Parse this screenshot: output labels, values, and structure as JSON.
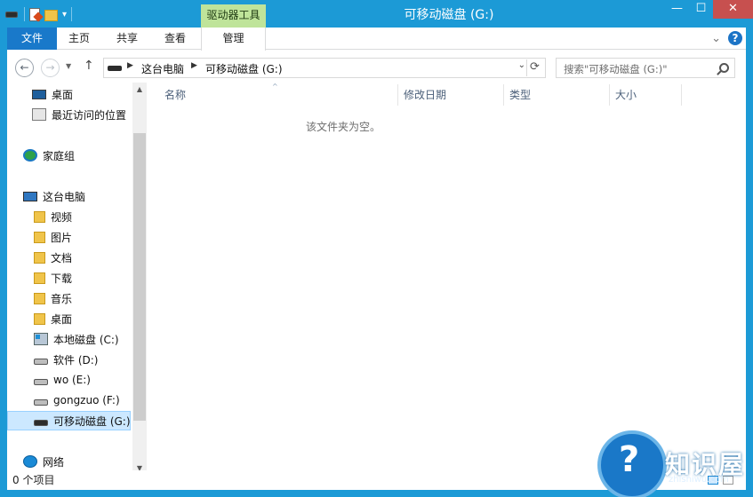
{
  "window": {
    "title": "可移动磁盘 (G:)",
    "contextual_tab_group": "驱动器工具",
    "minimize": "—",
    "maximize": "☐",
    "close": "✕"
  },
  "quick_access": {
    "dropdown": "▾"
  },
  "ribbon": {
    "tabs": [
      "文件",
      "主页",
      "共享",
      "查看",
      "管理"
    ],
    "expand_glyph": "⌄",
    "help_glyph": "?"
  },
  "navbar": {
    "back": "←",
    "forward": "→",
    "recent": "▼",
    "up": "↑",
    "breadcrumb": [
      "这台电脑",
      "可移动磁盘 (G:)"
    ],
    "separator": "▶",
    "dropdown": "⌄",
    "refresh": "⟳",
    "search_placeholder": "搜索\"可移动磁盘 (G:)\""
  },
  "nav_pane": {
    "items": [
      {
        "label": "桌面",
        "icon": "desktop-icon"
      },
      {
        "label": "最近访问的位置",
        "icon": "recent-places-icon"
      },
      {
        "label": "家庭组",
        "icon": "homegroup-icon"
      },
      {
        "label": "这台电脑",
        "icon": "computer-icon"
      },
      {
        "label": "视频",
        "icon": "videos-folder-icon"
      },
      {
        "label": "图片",
        "icon": "pictures-folder-icon"
      },
      {
        "label": "文档",
        "icon": "documents-folder-icon"
      },
      {
        "label": "下载",
        "icon": "downloads-folder-icon"
      },
      {
        "label": "音乐",
        "icon": "music-folder-icon"
      },
      {
        "label": "桌面",
        "icon": "desktop-folder-icon"
      },
      {
        "label": "本地磁盘 (C:)",
        "icon": "local-disk-icon"
      },
      {
        "label": "软件 (D:)",
        "icon": "drive-icon"
      },
      {
        "label": "wo (E:)",
        "icon": "drive-icon"
      },
      {
        "label": "gongzuo (F:)",
        "icon": "drive-icon"
      },
      {
        "label": "可移动磁盘 (G:)",
        "icon": "usb-drive-icon",
        "selected": true
      },
      {
        "label": "网络",
        "icon": "network-icon"
      }
    ],
    "scroll_up": "▲",
    "scroll_down": "▼"
  },
  "file_list": {
    "columns": [
      "名称",
      "修改日期",
      "类型",
      "大小"
    ],
    "sort_indicator": "^",
    "empty_message": "该文件夹为空。"
  },
  "statusbar": {
    "item_count": "0 个项目"
  },
  "watermark": {
    "glyph": "?",
    "text": "知识屋",
    "url": "zhishiwu.com"
  }
}
